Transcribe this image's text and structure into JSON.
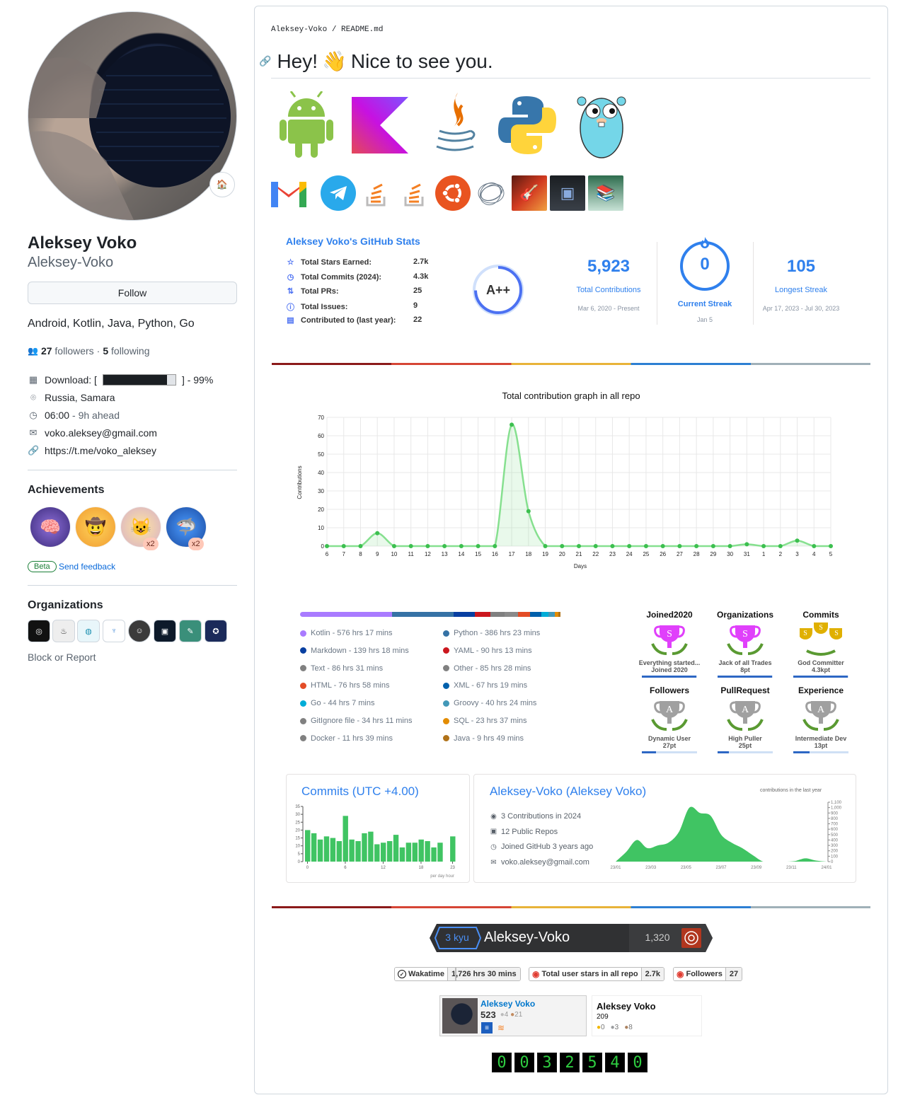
{
  "profile": {
    "full_name": "Aleksey Voko",
    "login": "Aleksey-Voko",
    "follow_label": "Follow",
    "bio": "Android, Kotlin, Java, Python, Go",
    "followers_count": "27",
    "followers_label": "followers",
    "following_count": "5",
    "following_label": "following",
    "download_label": "Download: [",
    "download_suffix": "] - 99%",
    "location": "Russia, Samara",
    "local_time": "06:00",
    "time_offset": "- 9h ahead",
    "email": "voko.aleksey@gmail.com",
    "link": "https://t.me/voko_aleksey",
    "achievements_heading": "Achievements",
    "achievement_counts": [
      "x2",
      "x2"
    ],
    "beta_label": "Beta",
    "feedback_label": "Send feedback",
    "organizations_heading": "Organizations",
    "block_label": "Block or Report",
    "progress_fraction": 0.99
  },
  "readme": {
    "breadcrumb_owner": "Aleksey-Voko",
    "breadcrumb_sep": "/",
    "breadcrumb_file": "README.md",
    "heading_a": "Hey!",
    "heading_emoji": "👋",
    "heading_b": "Nice to see you."
  },
  "stats": {
    "title": "Aleksey Voko's GitHub Stats",
    "rows": [
      {
        "label": "Total Stars Earned:",
        "value": "2.7k"
      },
      {
        "label": "Total Commits (2024):",
        "value": "4.3k"
      },
      {
        "label": "Total PRs:",
        "value": "25"
      },
      {
        "label": "Total Issues:",
        "value": "9"
      },
      {
        "label": "Contributed to (last year):",
        "value": "22"
      }
    ],
    "grade": "A++"
  },
  "streak": {
    "total": "5,923",
    "total_label": "Total Contributions",
    "total_range": "Mar 6, 2020 - Present",
    "current": "0",
    "current_label": "Current Streak",
    "current_range": "Jan 5",
    "longest": "105",
    "longest_label": "Longest Streak",
    "longest_range": "Apr 17, 2023 - Jul 30, 2023",
    "accent": "#2f80ed"
  },
  "chart_data": [
    {
      "type": "line",
      "title": "Total contribution graph in all repo",
      "xlabel": "Days",
      "ylabel": "Contributions",
      "ylim": [
        0,
        70
      ],
      "yticks": [
        "0",
        "10",
        "20",
        "30",
        "40",
        "50",
        "60",
        "70"
      ],
      "categories": [
        "6",
        "7",
        "8",
        "9",
        "10",
        "11",
        "12",
        "13",
        "14",
        "15",
        "16",
        "17",
        "18",
        "19",
        "20",
        "21",
        "22",
        "23",
        "24",
        "25",
        "26",
        "27",
        "28",
        "29",
        "30",
        "31",
        "1",
        "2",
        "3",
        "4",
        "5"
      ],
      "values": [
        0,
        0,
        0,
        7,
        0,
        0,
        0,
        0,
        0,
        0,
        0,
        66,
        19,
        0,
        0,
        0,
        0,
        0,
        0,
        0,
        0,
        0,
        0,
        0,
        0,
        1,
        0,
        0,
        3,
        0,
        0
      ],
      "color": "#86e08f",
      "grid": true
    },
    {
      "type": "bar",
      "title": "Commits (UTC +4.00)",
      "xlabel": "per day hour",
      "ylim": [
        0,
        35
      ],
      "yticks": [
        "0",
        "5",
        "10",
        "15",
        "20",
        "25",
        "30",
        "35"
      ],
      "xticks": [
        "0",
        "6",
        "12",
        "18",
        "23"
      ],
      "categories": [
        "0",
        "1",
        "2",
        "3",
        "4",
        "5",
        "6",
        "7",
        "8",
        "9",
        "10",
        "11",
        "12",
        "13",
        "14",
        "15",
        "16",
        "17",
        "18",
        "19",
        "20",
        "21",
        "22",
        "23"
      ],
      "values": [
        20,
        18,
        14,
        16,
        15,
        13,
        29,
        14,
        13,
        18,
        19,
        11,
        12,
        13,
        17,
        9,
        12,
        12,
        14,
        13,
        9,
        12,
        0,
        16
      ],
      "color": "#40c463"
    },
    {
      "type": "area",
      "title": "contributions in the last year",
      "xticks": [
        "23/01",
        "23/03",
        "23/05",
        "23/07",
        "23/09",
        "23/11",
        "24/01"
      ],
      "yticks": [
        "0",
        "100",
        "200",
        "300",
        "400",
        "500",
        "600",
        "700",
        "800",
        "900",
        "1,000",
        "1,100"
      ],
      "ylim": [
        0,
        1100
      ],
      "values": [
        0,
        180,
        400,
        250,
        300,
        350,
        550,
        1000,
        900,
        850,
        500,
        350,
        250,
        120,
        0,
        0,
        0,
        10,
        60,
        20,
        0
      ],
      "color": "#40c463"
    }
  ],
  "languages": {
    "bar": [
      {
        "color": "#A97BFF",
        "pct": 30
      },
      {
        "color": "#4F5D95",
        "pct": 0
      },
      {
        "color": "#3572A5",
        "pct": 20
      },
      {
        "color": "#083fa1",
        "pct": 7
      },
      {
        "color": "#cb171e",
        "pct": 5
      },
      {
        "color": "#808080",
        "pct": 4.5
      },
      {
        "color": "#8a8a8a",
        "pct": 4.5
      },
      {
        "color": "#e34c26",
        "pct": 4
      },
      {
        "color": "#0060ac",
        "pct": 3.5
      },
      {
        "color": "#00ADD8",
        "pct": 2.3
      },
      {
        "color": "#4298b8",
        "pct": 2.1
      },
      {
        "color": "#e38c00",
        "pct": 1.2
      },
      {
        "color": "#b07219",
        "pct": 0.6
      }
    ],
    "left": [
      {
        "label": "Kotlin - 576 hrs 17 mins",
        "color": "#A97BFF"
      },
      {
        "label": "Markdown - 139 hrs 18 mins",
        "color": "#083fa1"
      },
      {
        "label": "Text - 86 hrs 31 mins",
        "color": "#808080"
      },
      {
        "label": "HTML - 76 hrs 58 mins",
        "color": "#e34c26"
      },
      {
        "label": "Go - 44 hrs 7 mins",
        "color": "#00ADD8"
      },
      {
        "label": "GitIgnore file - 34 hrs 11 mins",
        "color": "#808080"
      },
      {
        "label": "Docker - 11 hrs 39 mins",
        "color": "#808080"
      }
    ],
    "right": [
      {
        "label": "Python - 386 hrs 23 mins",
        "color": "#3572A5"
      },
      {
        "label": "YAML - 90 hrs 13 mins",
        "color": "#cb171e"
      },
      {
        "label": "Other - 85 hrs 28 mins",
        "color": "#808080"
      },
      {
        "label": "XML - 67 hrs 19 mins",
        "color": "#0060ac"
      },
      {
        "label": "Groovy - 40 hrs 24 mins",
        "color": "#4298b8"
      },
      {
        "label": "SQL - 23 hrs 37 mins",
        "color": "#e38c00"
      },
      {
        "label": "Java - 9 hrs 49 mins",
        "color": "#b07219"
      }
    ]
  },
  "trophies": [
    {
      "title": "Joined2020",
      "rank": "S",
      "name": "Everything started...",
      "pt": "Joined 2020",
      "level": 0.99,
      "color": "#e040fb"
    },
    {
      "title": "Organizations",
      "rank": "S",
      "name": "Jack of all Trades",
      "pt": "8pt",
      "level": 0.99,
      "color": "#e040fb"
    },
    {
      "title": "Commits",
      "rank": "SSS",
      "name": "God Committer",
      "pt": "4.3kpt",
      "level": 0.99,
      "color": "#e0b000"
    },
    {
      "title": "Followers",
      "rank": "A",
      "name": "Dynamic User",
      "pt": "27pt",
      "level": 0.25,
      "color": "#a0a0a0"
    },
    {
      "title": "PullRequest",
      "rank": "A",
      "name": "High Puller",
      "pt": "25pt",
      "level": 0.2,
      "color": "#a0a0a0"
    },
    {
      "title": "Experience",
      "rank": "A",
      "name": "Intermediate Dev",
      "pt": "13pt",
      "level": 0.3,
      "color": "#a0a0a0"
    }
  ],
  "profile_card": {
    "title": "Aleksey-Voko (Aleksey Voko)",
    "rows": [
      {
        "icon": "github-icon",
        "glyph": "◉",
        "text": "3 Contributions in 2024"
      },
      {
        "icon": "repo-icon",
        "glyph": "▣",
        "text": "12 Public Repos"
      },
      {
        "icon": "clock-icon",
        "glyph": "◷",
        "text": "Joined GitHub 3 years ago"
      },
      {
        "icon": "mail-icon",
        "glyph": "✉",
        "text": "voko.aleksey@gmail.com"
      }
    ],
    "contrib_label": "contributions in the last year"
  },
  "codewars": {
    "rank": "3 kyu",
    "name": "Aleksey-Voko",
    "honor": "1,320"
  },
  "shields": [
    {
      "left": "Wakatime",
      "right": "1,726 hrs 30 mins"
    },
    {
      "left": "Total user stars in all repo",
      "right": "2.7k"
    },
    {
      "left": "Followers",
      "right": "27"
    }
  ],
  "stackoverflow": {
    "name": "Aleksey Voko",
    "rep": "523",
    "silver": "4",
    "bronze": "21"
  },
  "leetcode": {
    "name": "Aleksey Voko",
    "rep": "209",
    "gold": "0",
    "silver": "3",
    "bronze": "8"
  },
  "counter": [
    "0",
    "0",
    "3",
    "2",
    "5",
    "4",
    "0"
  ]
}
